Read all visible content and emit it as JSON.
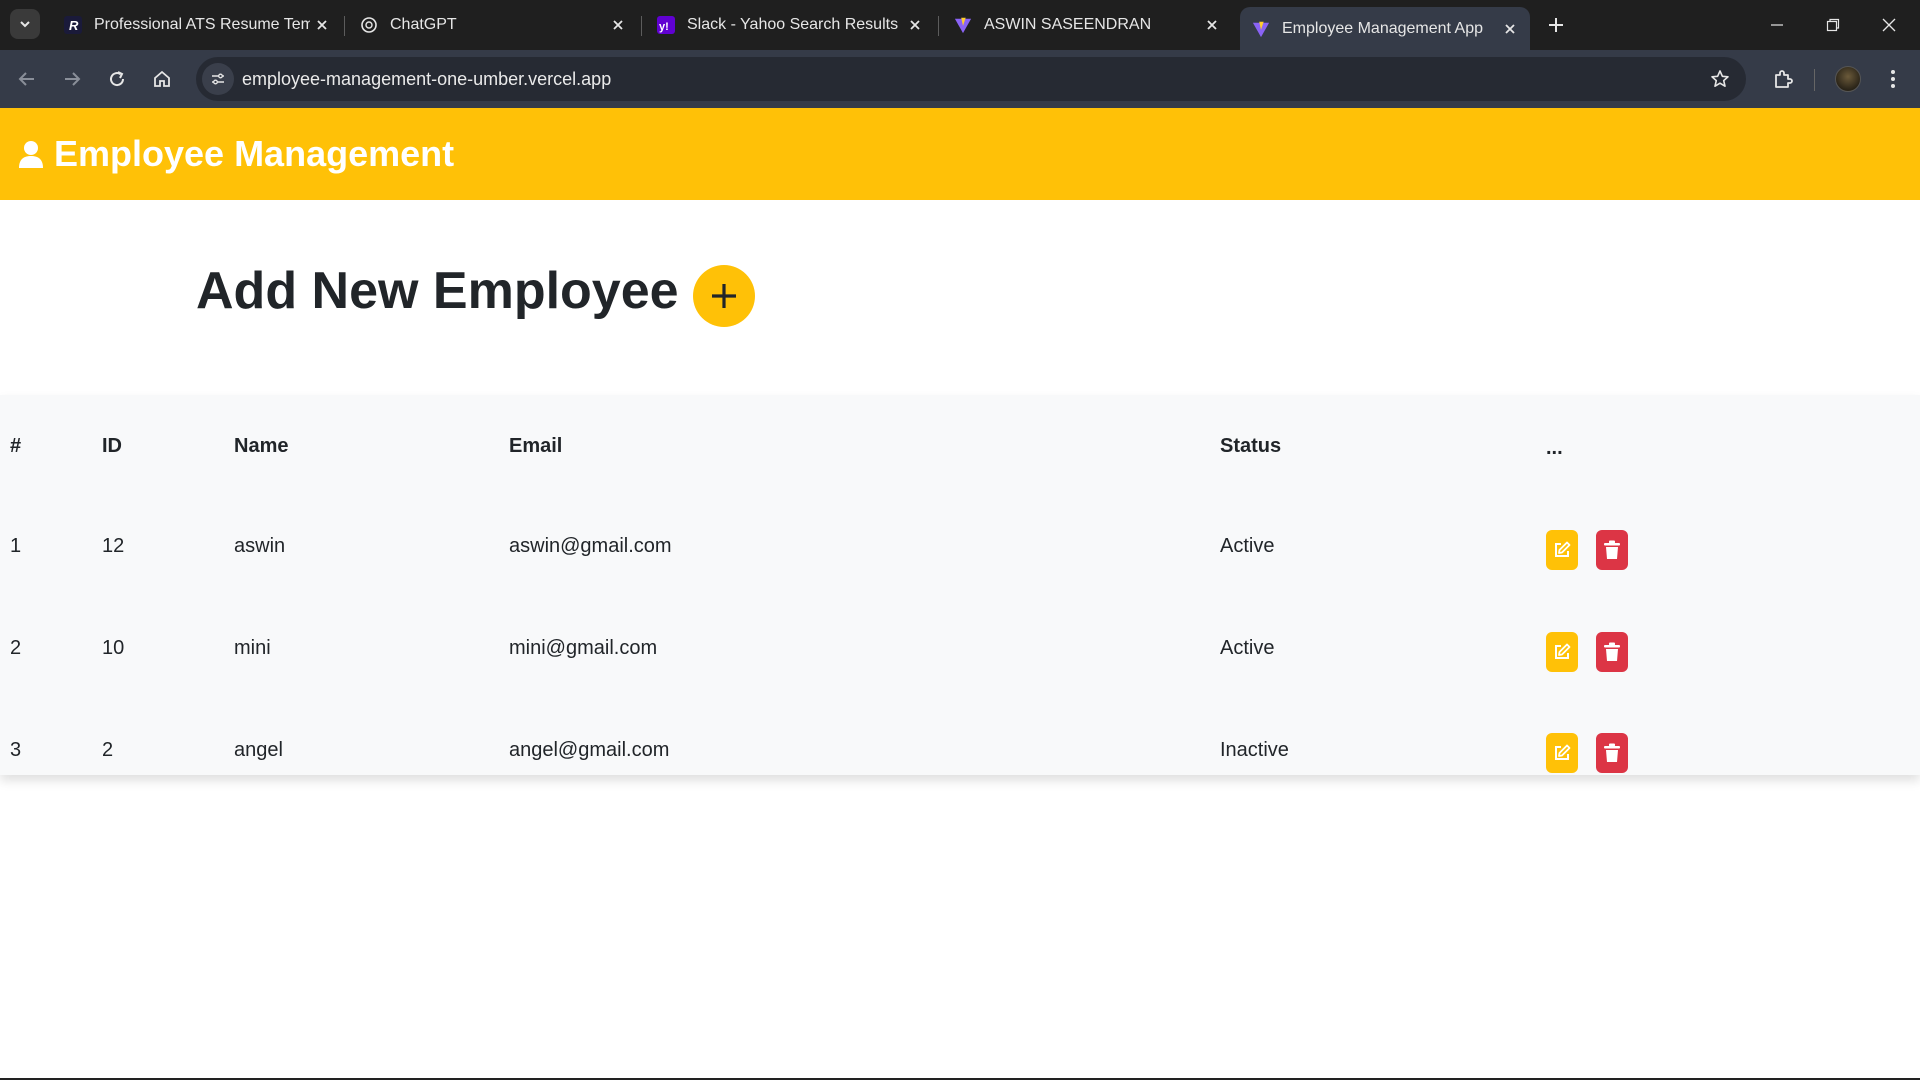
{
  "browser": {
    "tabs": [
      {
        "title": "Professional ATS Resume Templ",
        "favicon": "resume-r-icon"
      },
      {
        "title": "ChatGPT",
        "favicon": "chatgpt-icon"
      },
      {
        "title": "Slack - Yahoo Search Results",
        "favicon": "yahoo-icon"
      },
      {
        "title": "ASWIN SASEENDRAN",
        "favicon": "vite-icon"
      },
      {
        "title": "Employee Management App",
        "favicon": "vite-icon",
        "active": true
      }
    ],
    "url": "employee-management-one-umber.vercel.app"
  },
  "app": {
    "title": "Employee Management",
    "add_title": "Add New Employee",
    "add_button": "+",
    "accent": "#ffc107",
    "danger": "#dc3545"
  },
  "table": {
    "headers": [
      "#",
      "ID",
      "Name",
      "Email",
      "Status",
      "..."
    ],
    "rows": [
      {
        "index": "1",
        "id": "12",
        "name": "aswin",
        "email": "aswin@gmail.com",
        "status": "Active"
      },
      {
        "index": "2",
        "id": "10",
        "name": "mini",
        "email": "mini@gmail.com",
        "status": "Active"
      },
      {
        "index": "3",
        "id": "2",
        "name": "angel",
        "email": "angel@gmail.com",
        "status": "Inactive"
      }
    ]
  }
}
